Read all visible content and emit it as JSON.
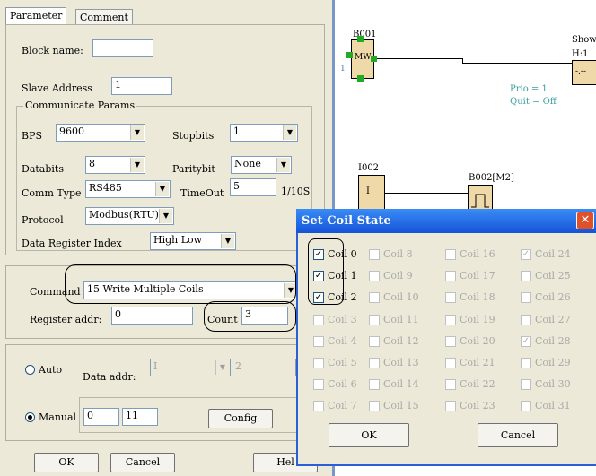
{
  "tabs": {
    "parameter": "Parameter",
    "comment": "Comment"
  },
  "block": {
    "name_label": "Block name:",
    "name_value": ""
  },
  "slave": {
    "label": "Slave Address",
    "value": "1"
  },
  "comm_params": {
    "title": "Communicate Params",
    "bps_label": "BPS",
    "bps_value": "9600",
    "stopbits_label": "Stopbits",
    "stopbits_value": "1",
    "databits_label": "Databits",
    "databits_value": "8",
    "paritybit_label": "Paritybit",
    "paritybit_value": "None",
    "commtype_label": "Comm Type",
    "commtype_value": "RS485",
    "timeout_label": "TimeOut",
    "timeout_value": "5",
    "timeout_unit": "1/10S",
    "protocol_label": "Protocol",
    "protocol_value": "Modbus(RTU)",
    "dri_label": "Data Register Index",
    "dri_value": "High Low"
  },
  "command": {
    "label": "Command",
    "value": "15 Write Multiple Coils",
    "reg_label": "Register addr:",
    "reg_value": "0",
    "count_label": "Count",
    "count_value": "3"
  },
  "auto": {
    "label": "Auto",
    "data_addr_label": "Data addr:",
    "data_addr_value": "I",
    "second_value": "2"
  },
  "manual": {
    "label": "Manual",
    "from_value": "0",
    "to_value": "11",
    "config_label": "Config"
  },
  "footer": {
    "ok": "OK",
    "cancel": "Cancel",
    "help": "Hel"
  },
  "diagram": {
    "b001": "B001",
    "b001_inner": "MW",
    "pin_one": "1",
    "show": "Show",
    "h1": "H:1",
    "h1_box": "-.--",
    "prio": "Prio = 1",
    "quit": "Quit = Off",
    "i002": "I002",
    "i_box": "I",
    "b002": "B002[M2]"
  },
  "dialog": {
    "title": "Set Coil State",
    "ok": "OK",
    "cancel": "Cancel",
    "coils": [
      {
        "label": "Coil 0",
        "checked": true,
        "enabled": true
      },
      {
        "label": "Coil 1",
        "checked": true,
        "enabled": true
      },
      {
        "label": "Coil 2",
        "checked": true,
        "enabled": true
      },
      {
        "label": "Coil 3",
        "checked": false,
        "enabled": false
      },
      {
        "label": "Coil 4",
        "checked": false,
        "enabled": false
      },
      {
        "label": "Coil 5",
        "checked": false,
        "enabled": false
      },
      {
        "label": "Coil 6",
        "checked": false,
        "enabled": false
      },
      {
        "label": "Coil 7",
        "checked": false,
        "enabled": false
      },
      {
        "label": "Coil 8",
        "checked": false,
        "enabled": false
      },
      {
        "label": "Coil 9",
        "checked": false,
        "enabled": false
      },
      {
        "label": "Coil 10",
        "checked": false,
        "enabled": false
      },
      {
        "label": "Coil 11",
        "checked": false,
        "enabled": false
      },
      {
        "label": "Coil 12",
        "checked": false,
        "enabled": false
      },
      {
        "label": "Coil 13",
        "checked": false,
        "enabled": false
      },
      {
        "label": "Coil 14",
        "checked": false,
        "enabled": false
      },
      {
        "label": "Coil 15",
        "checked": false,
        "enabled": false
      },
      {
        "label": "Coil 16",
        "checked": false,
        "enabled": false
      },
      {
        "label": "Coil 17",
        "checked": false,
        "enabled": false
      },
      {
        "label": "Coil 18",
        "checked": false,
        "enabled": false
      },
      {
        "label": "Coil 19",
        "checked": false,
        "enabled": false
      },
      {
        "label": "Coil 20",
        "checked": false,
        "enabled": false
      },
      {
        "label": "Coil 21",
        "checked": false,
        "enabled": false
      },
      {
        "label": "Coil 22",
        "checked": false,
        "enabled": false
      },
      {
        "label": "Coil 23",
        "checked": false,
        "enabled": false
      },
      {
        "label": "Coil 24",
        "checked": true,
        "enabled": false
      },
      {
        "label": "Coil 25",
        "checked": false,
        "enabled": false
      },
      {
        "label": "Coil 26",
        "checked": false,
        "enabled": false
      },
      {
        "label": "Coil 27",
        "checked": false,
        "enabled": false
      },
      {
        "label": "Coil 28",
        "checked": true,
        "enabled": false
      },
      {
        "label": "Coil 29",
        "checked": false,
        "enabled": false
      },
      {
        "label": "Coil 30",
        "checked": false,
        "enabled": false
      },
      {
        "label": "Coil 31",
        "checked": false,
        "enabled": false
      }
    ]
  }
}
